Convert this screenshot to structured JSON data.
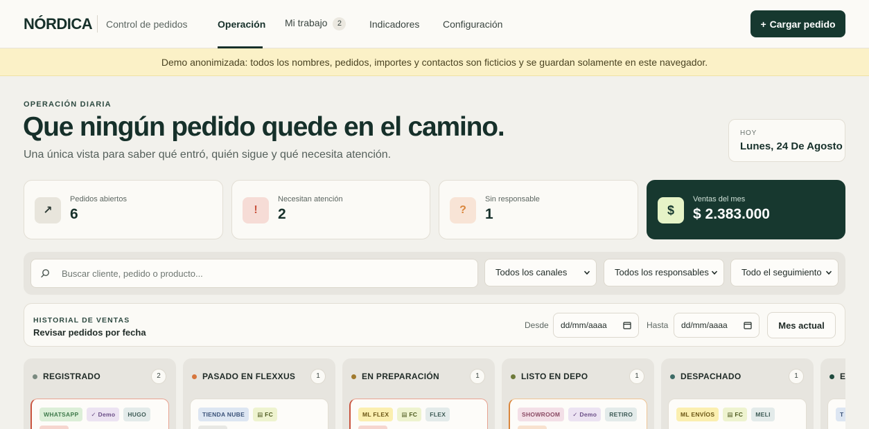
{
  "header": {
    "logo": "NÓRDICA",
    "subtitle": "Control de pedidos",
    "nav": [
      {
        "label": "Operación",
        "active": true
      },
      {
        "label": "Mi trabajo",
        "badge": "2"
      },
      {
        "label": "Indicadores"
      },
      {
        "label": "Configuración"
      }
    ],
    "cta_label": "Cargar pedido",
    "cta_icon": "+"
  },
  "banner": "Demo anonimizada: todos los nombres, pedidos, importes y contactos son ficticios y se guardan solamente en este navegador.",
  "hero": {
    "eyebrow": "OPERACIÓN DIARIA",
    "title": "Que ningún pedido quede en el camino.",
    "lead": "Una única vista para saber qué entró, quién sigue y qué necesita atención.",
    "today_label": "HOY",
    "today_value": "Lunes, 24 De Agosto"
  },
  "stats": [
    {
      "label": "Pedidos abiertos",
      "value": "6",
      "icon": "↗",
      "icon_name": "trend-arrow-icon"
    },
    {
      "label": "Necesitan atención",
      "value": "2",
      "icon": "!",
      "icon_name": "alert-icon"
    },
    {
      "label": "Sin responsable",
      "value": "1",
      "icon": "?",
      "icon_name": "question-icon"
    },
    {
      "label": "Ventas del mes",
      "value": "$ 2.383.000",
      "icon": "$",
      "icon_name": "dollar-icon"
    }
  ],
  "filters": {
    "search_placeholder": "Buscar cliente, pedido o producto...",
    "channel": "Todos los canales",
    "owner": "Todos los responsables",
    "followup": "Todo el seguimiento"
  },
  "history": {
    "eyebrow": "HISTORIAL DE VENTAS",
    "title": "Revisar pedidos por fecha",
    "from_label": "Desde",
    "to_label": "Hasta",
    "from_value": "dd/mm/aaaa",
    "to_value": "dd/mm/aaaa",
    "month_button": "Mes actual"
  },
  "columns": [
    {
      "title": "REGISTRADO",
      "count": "2",
      "dot": "#7a8a80",
      "tags": [
        "WHATSAPP",
        "Demo",
        "HUGO"
      ]
    },
    {
      "title": "PASADO EN FLEXXUS",
      "count": "1",
      "dot": "#d6763d",
      "tags": [
        "TIENDA NUBE",
        "FC"
      ]
    },
    {
      "title": "EN PREPARACIÓN",
      "count": "1",
      "dot": "#a07a2e",
      "tags": [
        "ML FLEX",
        "FC",
        "FLEX"
      ]
    },
    {
      "title": "LISTO EN DEPO",
      "count": "1",
      "dot": "#6e7a3a",
      "tags": [
        "SHOWROOM",
        "Demo",
        "RETIRO"
      ]
    },
    {
      "title": "DESPACHADO",
      "count": "1",
      "dot": "#3d6b66",
      "tags": [
        "ML ENVÍOS",
        "FC",
        "MELI"
      ]
    },
    {
      "title": "EN",
      "count": "",
      "dot": "#1f4a3e",
      "tags": [
        "T"
      ]
    }
  ],
  "colors": {
    "brand_dark": "#16382f",
    "banner_bg": "#fbf1c7",
    "alert_red": "#c9533e",
    "warning_orange": "#d9853b"
  }
}
